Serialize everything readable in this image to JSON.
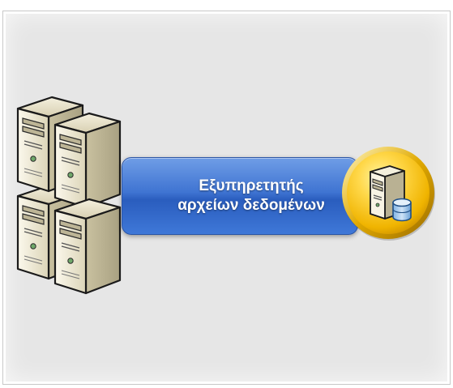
{
  "diagram": {
    "banner": {
      "line1": "Εξυπηρετητής",
      "line2": "αρχείων δεδομένων"
    },
    "icons": {
      "cluster": "server-cluster-icon",
      "badge": "database-server-icon"
    },
    "colors": {
      "panel_background": "#e6e6e6",
      "banner_blue": "#3f74d2",
      "badge_yellow": "#f5c400",
      "server_beige": "#efe9d2"
    }
  }
}
